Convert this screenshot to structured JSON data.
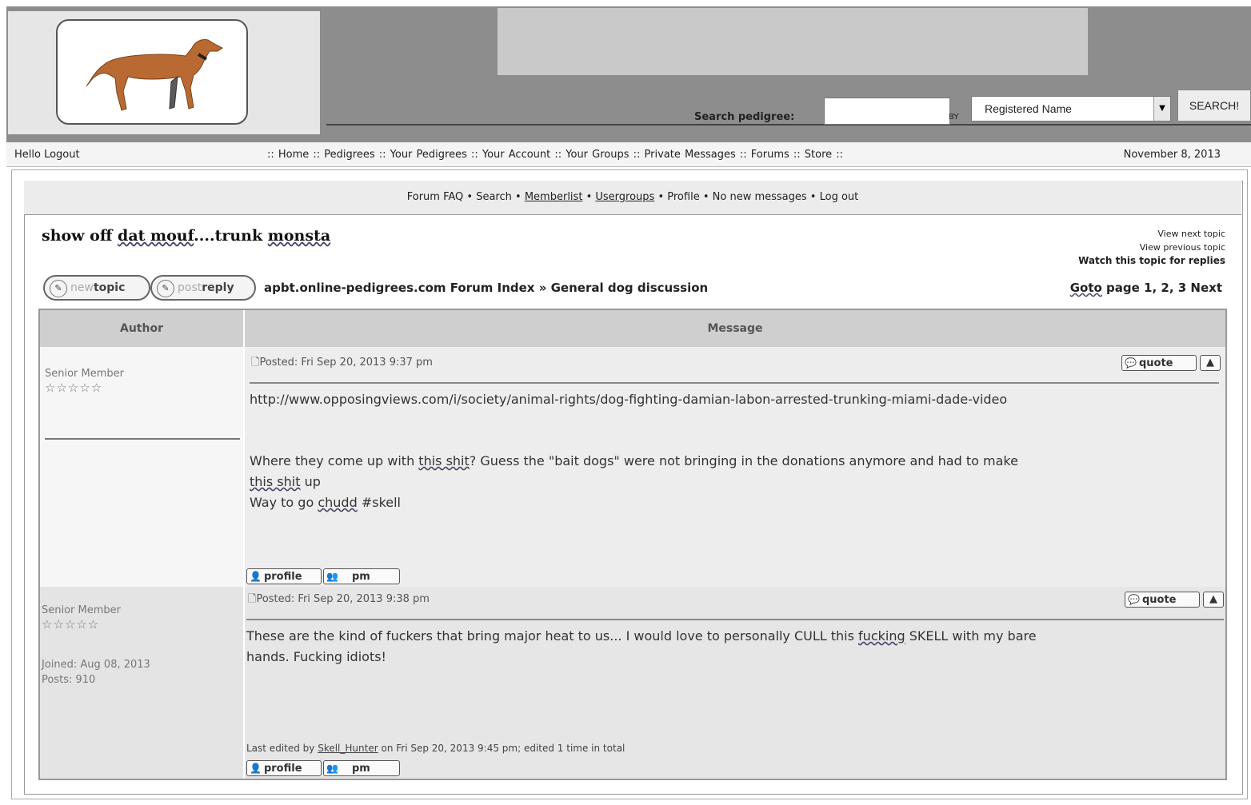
{
  "header": {
    "search_label": "Search pedigree:",
    "search_value": "",
    "by_label": "BY",
    "search_by": "Registered Name",
    "search_button": "SEARCH!"
  },
  "nav": {
    "greeting": "Hello Logout",
    "links": ":: Home :: Pedigrees :: Your Pedigrees :: Your Account :: Your Groups :: Private Messages :: Forums :: Store ::",
    "date": "November 8, 2013"
  },
  "forum_menu": {
    "faq": "Forum FAQ",
    "search": "Search",
    "memberlist": "Memberlist",
    "usergroups": "Usergroups",
    "profile": "Profile",
    "messages": "No new messages",
    "logout": "Log out",
    "separator": "•"
  },
  "topic": {
    "title_1": "show off ",
    "title_2": "dat mouf",
    "title_3": "....trunk ",
    "title_4": "monsta",
    "view_next": "View next topic",
    "view_previous": "View previous topic",
    "watch": "Watch this topic for replies",
    "new_topic_1": "new",
    "new_topic_2": "topic",
    "post_reply_1": "post",
    "post_reply_2": "reply",
    "breadcrumb": "apbt.online-pedigrees.com Forum Index » General dog discussion",
    "goto_word": "Goto",
    "goto_pages": " page 1, 2, 3 Next"
  },
  "table": {
    "author_header": "Author",
    "message_header": "Message"
  },
  "posts": [
    {
      "rank": "Senior Member",
      "stars": "☆☆☆☆☆",
      "posted": "Posted: Fri Sep 20, 2013 9:37 pm",
      "quote": "quote",
      "link": "http://www.opposingviews.com/i/society/animal-rights/dog-fighting-damian-labon-arrested-trunking-miami-dade-video",
      "line1_a": "Where they come up with ",
      "line1_b": "this shit",
      "line1_c": "?  Guess the \"bait dogs\" were not bringing in the donations anymore and had to make",
      "line2_a": "this shit",
      "line2_b": " up",
      "line3_a": "Way to go ",
      "line3_b": "chudd",
      "line3_c": " #skell",
      "profile": "profile",
      "pm": "pm"
    },
    {
      "rank": "Senior Member",
      "stars": "☆☆☆☆☆",
      "joined": "Joined: Aug 08, 2013",
      "posts": "Posts: 910",
      "posted": "Posted: Fri Sep 20, 2013 9:38 pm",
      "quote": "quote",
      "line1_a": "These are the kind of fuckers that bring major heat to us... I would love to personally CULL this ",
      "line1_b": "fucking",
      "line1_c": " SKELL with my bare",
      "line2": "hands. Fucking idiots!",
      "edit_a": "Last edited by ",
      "edit_user": "Skell_Hunter",
      "edit_b": " on Fri Sep 20, 2013 9:45 pm; edited 1 time in total",
      "profile": "profile",
      "pm": "pm"
    }
  ],
  "colors": {
    "header_gray": "#8d8d8d",
    "panel_light": "#e6e6e6",
    "table_header": "#cfcfcf"
  }
}
